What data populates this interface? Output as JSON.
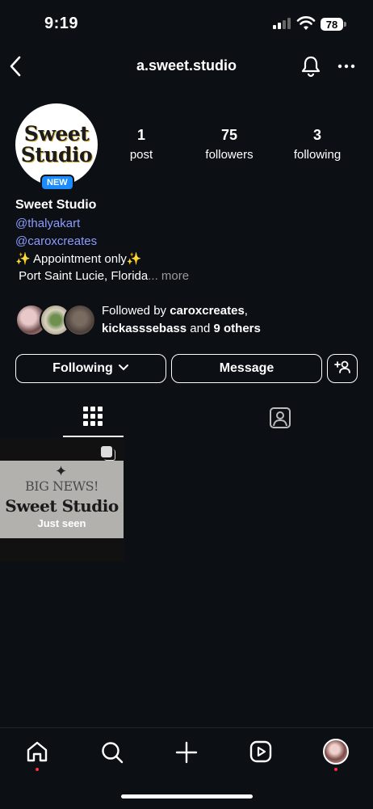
{
  "status_bar": {
    "time": "9:19",
    "battery": "78"
  },
  "header": {
    "username": "a.sweet.studio"
  },
  "profile": {
    "avatar_text": [
      "Sweet",
      "Studio"
    ],
    "badge": "NEW",
    "stats": [
      {
        "value": "1",
        "label": "post"
      },
      {
        "value": "75",
        "label": "followers"
      },
      {
        "value": "3",
        "label": "following"
      }
    ],
    "name": "Sweet Studio",
    "links": [
      "@thalyakart",
      "@caroxcreates"
    ],
    "bio_line1": "✨ Appointment only✨",
    "bio_line2": " Port Saint Lucie, Florida",
    "bio_more": "... more",
    "followed_by": {
      "prefix": "Followed by ",
      "name1": "caroxcreates",
      "sep": ",",
      "name2": "kickasssebass",
      "and": " and ",
      "others": "9 others"
    }
  },
  "buttons": {
    "following": "Following",
    "message": "Message"
  },
  "tabs": [
    "posts-grid",
    "tagged"
  ],
  "posts": [
    {
      "star": "✦",
      "line1": "BIG NEWS!",
      "line2": "Sweet Studio",
      "overlay": "Just seen"
    }
  ],
  "nav": [
    "home",
    "search",
    "create",
    "reels",
    "profile"
  ],
  "colors": {
    "background": "#0c0f14",
    "link": "#8c9cff",
    "badge": "#1a8cff",
    "notification_dot": "#ff3040"
  }
}
